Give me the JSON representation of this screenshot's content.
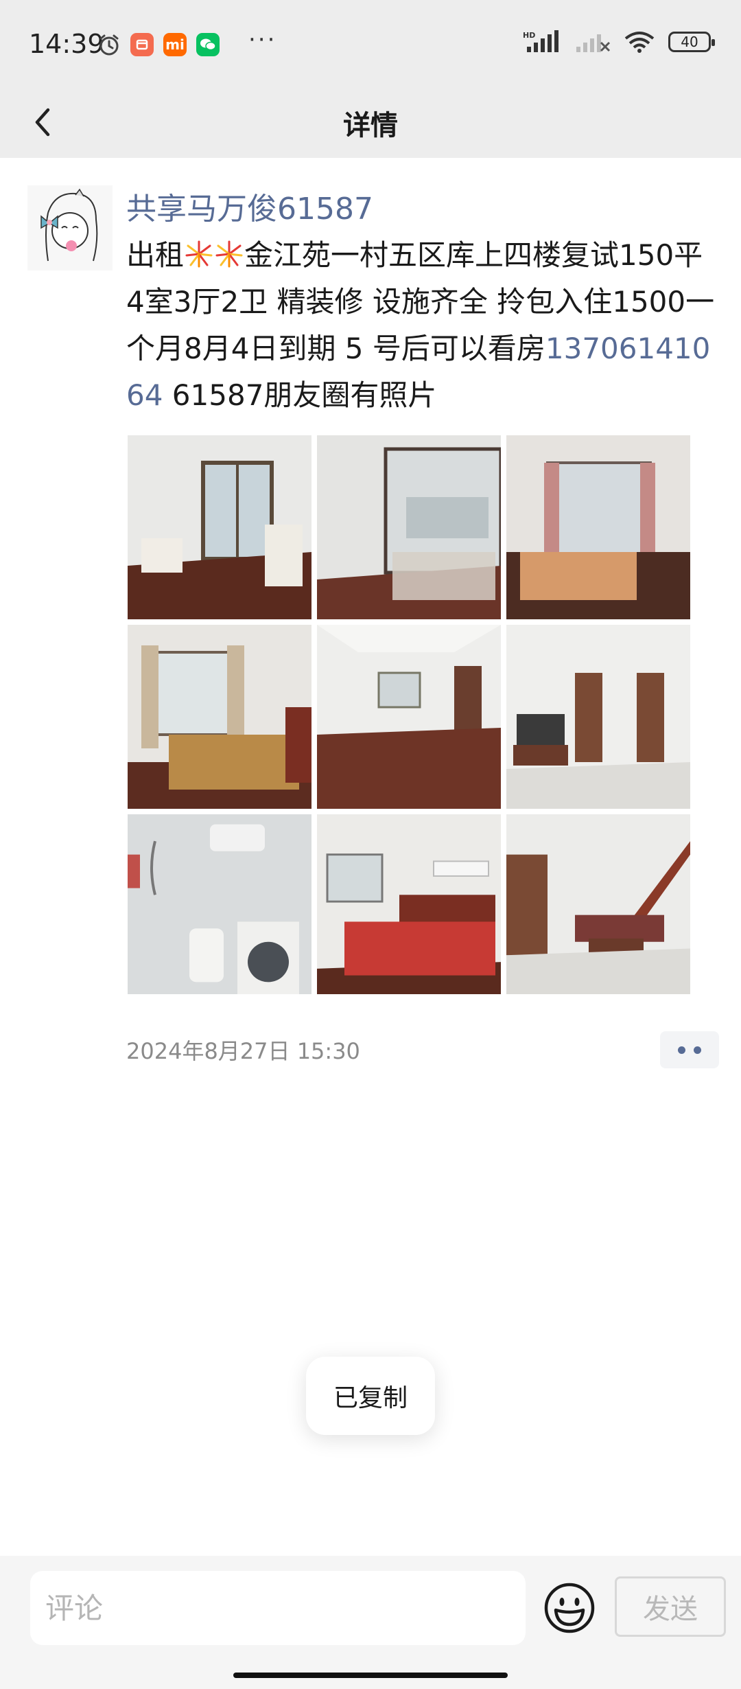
{
  "status_bar": {
    "time": "14:39",
    "icons": [
      "alarm-icon",
      "app-icon-orange",
      "mi-icon",
      "wechat-icon",
      "more-dots-icon",
      "hd-signal-icon",
      "signal-icon",
      "wifi-icon",
      "battery-icon"
    ],
    "mi_label": "mi",
    "dots": "···",
    "hd_label": "HD",
    "battery_level": "40"
  },
  "nav": {
    "title": "详情"
  },
  "post": {
    "author": "共享马万俊61587",
    "text_part1": "出租",
    "text_part2": "金江苑一村五区库上四楼复试150平4室3厅2卫  精装修  设施齐全  拎包入住1500一个月8月4日到期   5 号后可以看房",
    "phone": "13706141064",
    "text_part3": "  61587朋友圈有照片",
    "photos": [
      "photo-1",
      "photo-2",
      "photo-3",
      "photo-4",
      "photo-5",
      "photo-6",
      "photo-7",
      "photo-8",
      "photo-9"
    ],
    "time": "2024年8月27日 15:30"
  },
  "toast": {
    "text": "已复制"
  },
  "bottom": {
    "comment_placeholder": "评论",
    "send_label": "发送"
  },
  "colors": {
    "link": "#576b95",
    "bar_bg": "#ededed"
  }
}
